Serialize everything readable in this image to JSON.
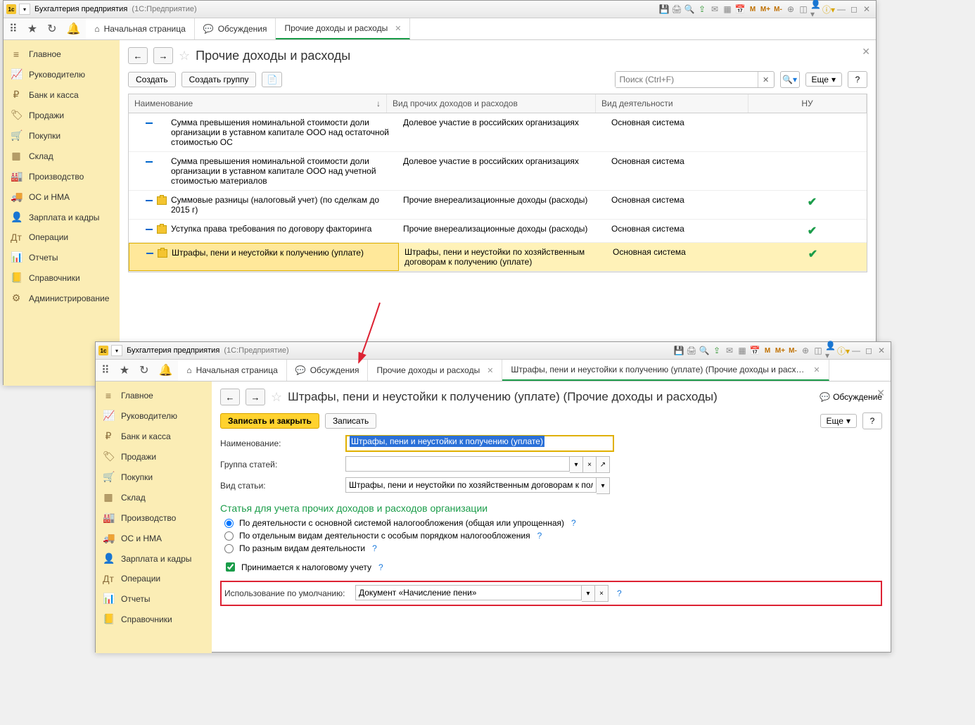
{
  "win1": {
    "title_app": "Бухгалтерия предприятия",
    "title_conf": "(1С:Предприятие)",
    "tabs": {
      "home": "Начальная страница",
      "discuss": "Обсуждения",
      "other": "Прочие доходы и расходы"
    },
    "sidebar": [
      {
        "icon": "≡",
        "label": "Главное"
      },
      {
        "icon": "📈",
        "label": "Руководителю"
      },
      {
        "icon": "₽",
        "label": "Банк и касса"
      },
      {
        "icon": "🏷",
        "label": "Продажи"
      },
      {
        "icon": "🛒",
        "label": "Покупки"
      },
      {
        "icon": "▦",
        "label": "Склад"
      },
      {
        "icon": "🏭",
        "label": "Производство"
      },
      {
        "icon": "🚚",
        "label": "ОС и НМА"
      },
      {
        "icon": "👤",
        "label": "Зарплата и кадры"
      },
      {
        "icon": "Дт",
        "label": "Операции"
      },
      {
        "icon": "📊",
        "label": "Отчеты"
      },
      {
        "icon": "📒",
        "label": "Справочники"
      },
      {
        "icon": "⚙",
        "label": "Администрирование"
      }
    ],
    "page": {
      "title": "Прочие доходы и расходы",
      "btn_create": "Создать",
      "btn_create_group": "Создать группу",
      "search_placeholder": "Поиск (Ctrl+F)",
      "more": "Еще",
      "columns": {
        "name": "Наименование",
        "kind": "Вид прочих доходов и расходов",
        "act": "Вид деятельности",
        "nu": "НУ"
      },
      "rows": [
        {
          "name": "Сумма превышения номинальной стоимости доли организации в уставном капитале ООО над остаточной стоимостью ОС",
          "kind": "Долевое участие в российских организациях",
          "act": "Основная система",
          "nu": false
        },
        {
          "name": "Сумма превышения номинальной стоимости доли организации в уставном капитале ООО над учетной стоимостью материалов",
          "kind": "Долевое участие в российских организациях",
          "act": "Основная система",
          "nu": false
        },
        {
          "name": "Суммовые разницы (налоговый учет) (по сделкам до 2015 г)",
          "kind": "Прочие внереализационные доходы (расходы)",
          "act": "Основная система",
          "nu": true,
          "folder": true
        },
        {
          "name": "Уступка права требования по договору факторинга",
          "kind": "Прочие внереализационные доходы (расходы)",
          "act": "Основная система",
          "nu": true,
          "folder": true
        },
        {
          "name": "Штрафы, пени и неустойки к получению (уплате)",
          "kind": "Штрафы, пени и неустойки по хозяйственным договорам к получению (уплате)",
          "act": "Основная система",
          "nu": true,
          "folder": true,
          "sel": true
        }
      ]
    }
  },
  "win2": {
    "title_app": "Бухгалтерия предприятия",
    "title_conf": "(1С:Предприятие)",
    "tabs": {
      "home": "Начальная страница",
      "discuss": "Обсуждения",
      "list": "Прочие доходы и расходы",
      "item": "Штрафы, пени и неустойки к получению (уплате) (Прочие доходы и расходы)"
    },
    "page": {
      "title": "Штрафы, пени и неустойки к получению (уплате) (Прочие доходы и расходы)",
      "discuss": "Обсуждение",
      "btn_save_close": "Записать и закрыть",
      "btn_save": "Записать",
      "more": "Еще",
      "fld_name_label": "Наименование:",
      "fld_name_value": "Штрафы, пени и неустойки к получению (уплате)",
      "fld_group_label": "Группа статей:",
      "fld_group_value": "",
      "fld_kind_label": "Вид статьи:",
      "fld_kind_value": "Штрафы, пени и неустойки по хозяйственным договорам к полу",
      "section_title": "Статья для учета прочих доходов и расходов организации",
      "radio1": "По деятельности с основной системой налогообложения (общая или упрощенная)",
      "radio2": "По отдельным видам деятельности с особым порядком налогообложения",
      "radio3": "По разным видам деятельности",
      "chk_nu": "Принимается к налоговому учету",
      "fld_default_label": "Использование по умолчанию:",
      "fld_default_value": "Документ «Начисление пени»"
    }
  }
}
